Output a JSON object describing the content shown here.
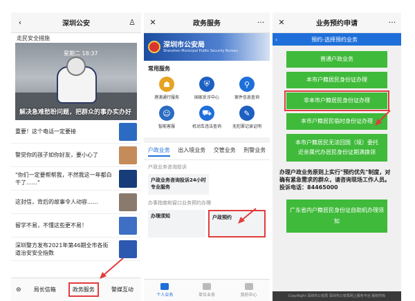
{
  "panel1": {
    "title": "深圳公安",
    "top_snippet": "走民安全措施",
    "hero": {
      "clock": "星期二 18:37",
      "caption": "解决急难愁盼问题，把群众的事办实办好"
    },
    "news": [
      {
        "text": "重要！这个电话一定要接",
        "thumb_color": "#2b6cc2"
      },
      {
        "text": "警觉你的孩子如你好友，要小心了",
        "thumb_color": "#c58b5a"
      },
      {
        "text": "\"你们一定要帮帮我，不然我这一年都白干了……\"",
        "thumb_color": "#163d7a"
      },
      {
        "text": "这封信，背后的故事令人动容……",
        "thumb_color": "#8a7a6d"
      },
      {
        "text": "留学不易，不懂这些更不易！",
        "thumb_color": "#3f6fc4"
      },
      {
        "text": "深圳警方发布2021年第46期全市各街道治安安全指数",
        "thumb_color": "#2c58b0"
      }
    ],
    "bottom": {
      "keyboard": "⊜",
      "left": "局长信箱",
      "middle": "政务服务",
      "right": "警媒互动"
    }
  },
  "panel2": {
    "title": "政务服务",
    "banner_name": "深圳市公安局",
    "banner_sub": "Shenzhen Municipal Public Security Bureau",
    "section": "常用服务",
    "services": [
      {
        "label": "港澳通行服务",
        "icon": "☗",
        "color": "#e7a322"
      },
      {
        "label": "国家反诈中心",
        "icon": "⛨",
        "color": "#1e5fc2"
      },
      {
        "label": "案件信息查询",
        "icon": "⚲",
        "color": "#1e6fd9"
      },
      {
        "label": "智能客服",
        "icon": "☺",
        "color": "#2b6cc2"
      },
      {
        "label": "机动车违法查询",
        "icon": "⛟",
        "color": "#1e6fd9"
      },
      {
        "label": "无犯罪记录证明",
        "icon": "✎",
        "color": "#1e5fc2"
      }
    ],
    "tabs": [
      "户政业务",
      "出入境业务",
      "交管业务",
      "刑警业务"
    ],
    "sub1": "户政业务咨询投诉",
    "card1": "户政业务咨询投诉24小时专业服务",
    "sub2": "办事指南和窗口业务预约办理",
    "cell_left": "办理须知",
    "cell_right": "户政预约",
    "bottom": [
      "个人业务",
      "单位业务",
      "我的中心"
    ]
  },
  "panel3": {
    "title": "业务预约申请",
    "blue_title": "预约-选择预约业务",
    "buttons": [
      "普通户政业务",
      "本市户籍居民身份证办理",
      "非本市户籍居民身份证办理",
      "本市户籍居民临时身份证办理",
      "本市户籍居民无法回国（境）委托近亲属代办居民身份证期满换领"
    ],
    "note": "办理户政业务原则上实行\"预约优先\"制度，对确有紧急需求的群众，请咨询现场工作人员。投诉电话：84465000",
    "green_box": "广东省内户籍居民身份证自助机办理须知",
    "footer": "CopyRight 深圳市公安局 深圳市公安局网上服务平台 版权所有"
  },
  "colors": {
    "accent_red": "#e23b3b",
    "green": "#3fba3a",
    "blue": "#1e6fd9"
  }
}
